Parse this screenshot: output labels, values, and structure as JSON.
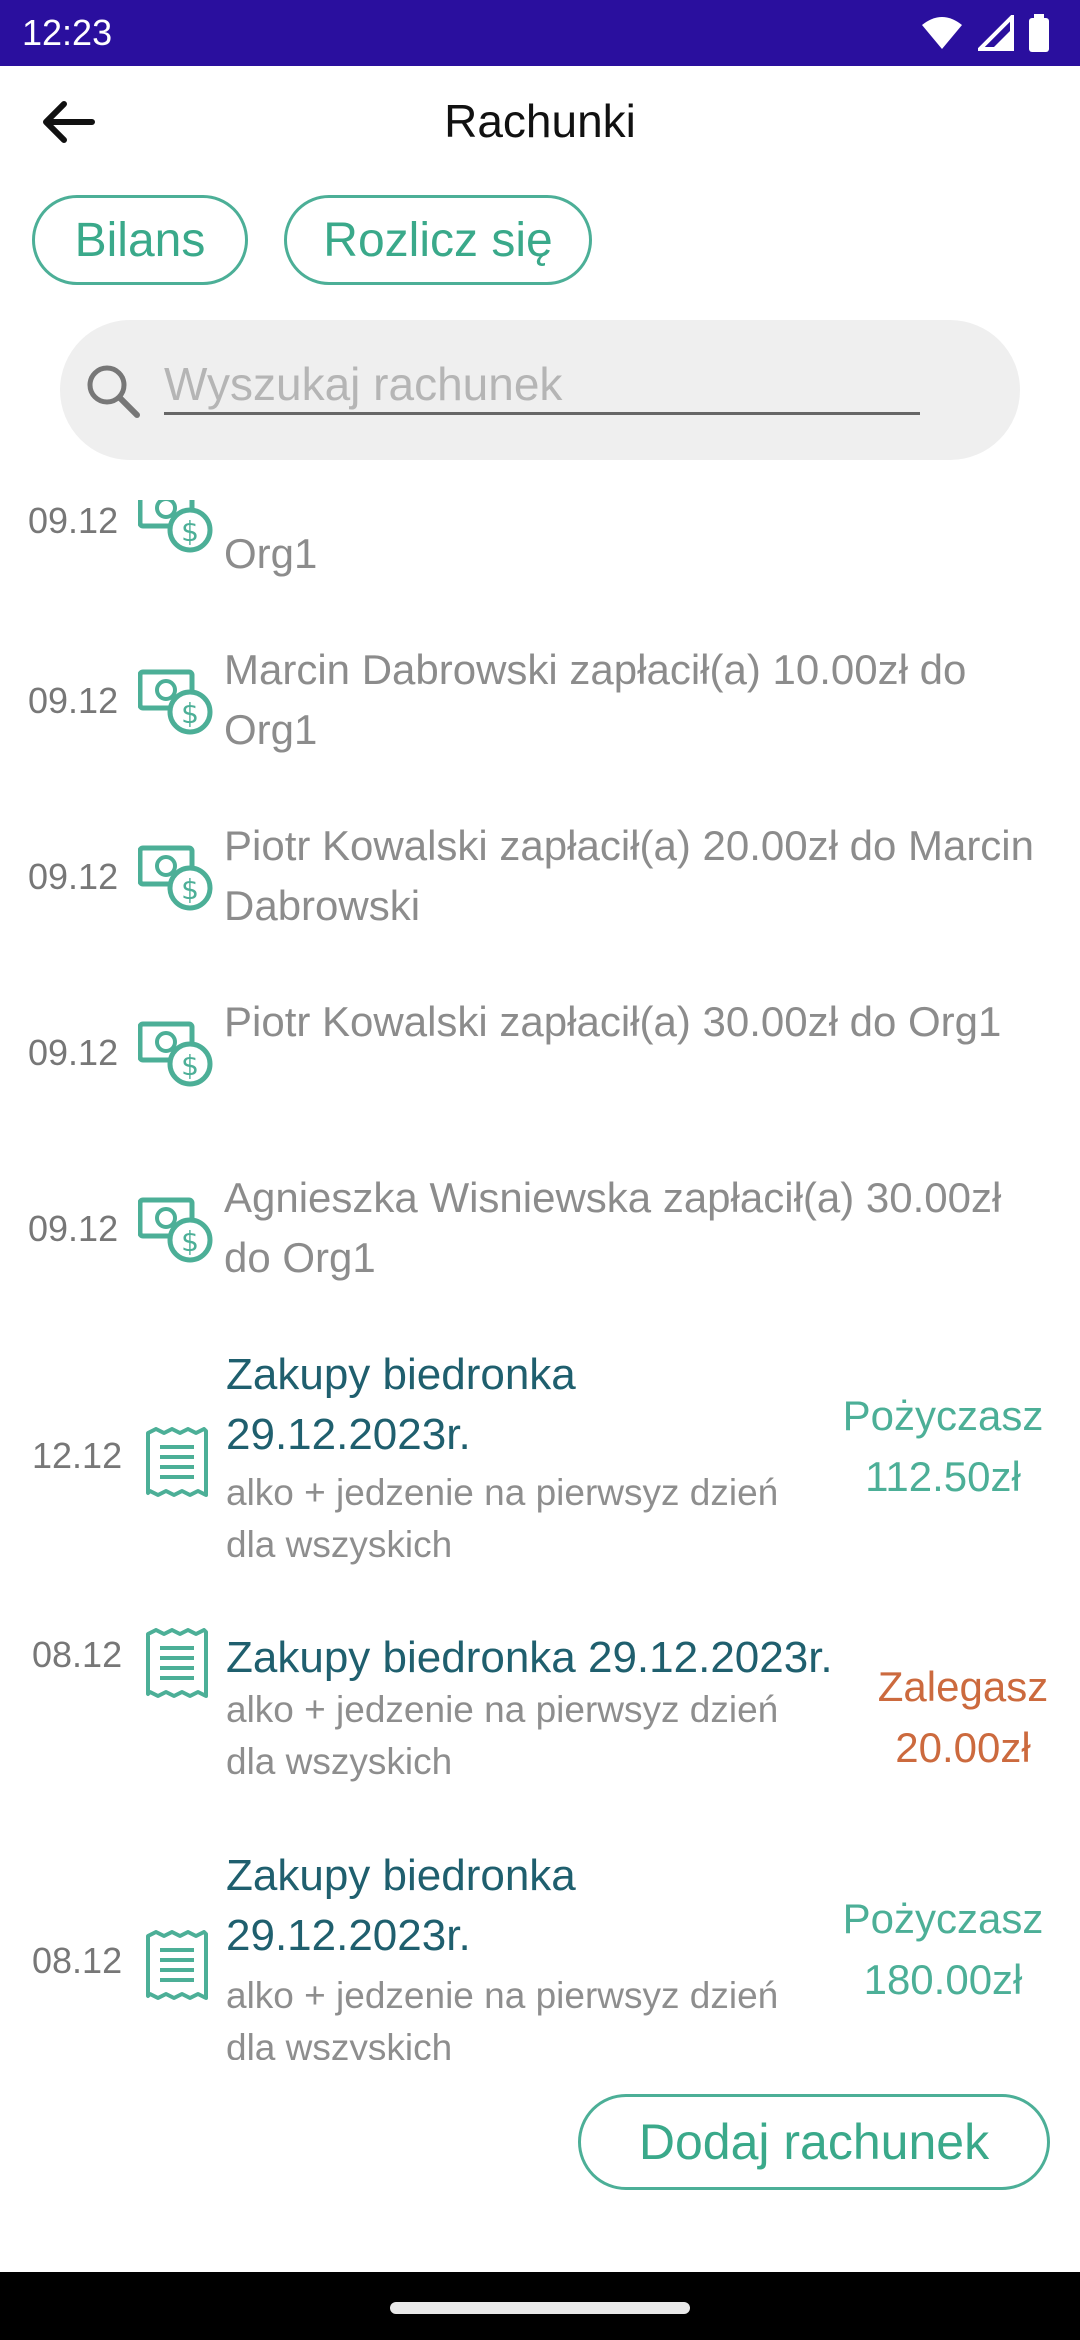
{
  "status_bar": {
    "time": "12:23"
  },
  "app_bar": {
    "title": "Rachunki"
  },
  "chips": {
    "bilans": "Bilans",
    "rozlicz": "Rozlicz się"
  },
  "search": {
    "placeholder": "Wyszukaj rachunek",
    "value": ""
  },
  "payments": [
    {
      "date": "09.12",
      "text": "Org1",
      "partially_visible": true
    },
    {
      "date": "09.12",
      "text": "Marcin Dabrowski zapłacił(a) 10.00zł do Org1"
    },
    {
      "date": "09.12",
      "text": "Piotr Kowalski zapłacił(a) 20.00zł do Marcin Dabrowski"
    },
    {
      "date": "09.12",
      "text": "Piotr Kowalski zapłacił(a) 30.00zł do Org1"
    },
    {
      "date": "09.12",
      "text": "Agnieszka Wisniewska zapłacił(a) 30.00zł do Org1"
    }
  ],
  "bills": [
    {
      "date": "12.12",
      "title": "Zakupy biedronka 29.12.2023r.",
      "description": "alko + jedzenie na pierwsyz dzień dla wszyskich",
      "status": "Pożyczasz",
      "amount": "112.50zł",
      "status_color": "#4caf97"
    },
    {
      "date": "08.12",
      "title": "Zakupy biedronka 29.12.2023r.",
      "description": "alko + jedzenie na pierwsyz dzień dla wszyskich",
      "status": "Zalegasz",
      "amount": "20.00zł",
      "status_color": "#cc6a3e"
    },
    {
      "date": "08.12",
      "title": "Zakupy biedronka 29.12.2023r.",
      "description": "alko + jedzenie na pierwsyz dzień dla wszyskich",
      "status": "Pożyczasz",
      "amount": "180.00zł",
      "status_color": "#4caf97"
    }
  ],
  "add_button": {
    "label": "Dodaj rachunek"
  },
  "colors": {
    "accent": "#4caf97",
    "status_bar": "#2a0f9e",
    "bill_title": "#1f5f6e",
    "owe": "#cc6a3e"
  },
  "icons": {
    "back": "arrow-left-icon",
    "search": "search-icon",
    "payment": "money-transfer-icon",
    "bill": "receipt-icon",
    "wifi": "wifi-icon",
    "signal": "signal-icon",
    "battery": "battery-icon"
  }
}
